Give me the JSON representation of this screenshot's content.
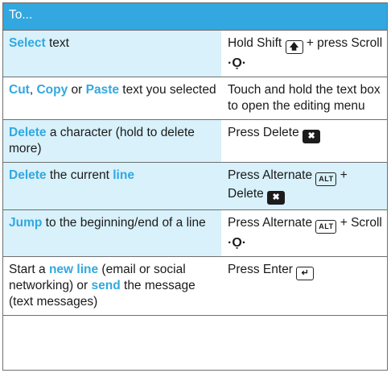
{
  "header": {
    "label": "To..."
  },
  "rows": [
    {
      "pre": "",
      "kw1": "Select",
      "mid1": " text",
      "kw2": "",
      "mid2": "",
      "kw3": "",
      "post": "",
      "action_pre": "Hold Shift ",
      "key1": "up-arrow-key",
      "action_mid": " + press Scroll ",
      "key2": "scroll-icon",
      "action_post": ""
    },
    {
      "pre": "",
      "kw1": "Cut",
      "mid1": ", ",
      "kw2": "Copy",
      "mid2": " or ",
      "kw3": "Paste",
      "post": " text you selected",
      "action_pre": "Touch and hold the text box to open the editing menu",
      "key1": "",
      "action_mid": "",
      "key2": "",
      "action_post": ""
    },
    {
      "pre": "",
      "kw1": "Delete",
      "mid1": " a character (hold to delete more)",
      "kw2": "",
      "mid2": "",
      "kw3": "",
      "post": "",
      "action_pre": "Press Delete ",
      "key1": "delete-key",
      "action_mid": "",
      "key2": "",
      "action_post": ""
    },
    {
      "pre": "",
      "kw1": "Delete",
      "mid1": " the current ",
      "kw2": "line",
      "mid2": "",
      "kw3": "",
      "post": "",
      "action_pre": "Press Alternate ",
      "key1": "alt-key",
      "action_mid": " + Delete ",
      "key2": "delete-key",
      "action_post": ""
    },
    {
      "pre": "",
      "kw1": "Jump",
      "mid1": " to the beginning/end of a line",
      "kw2": "",
      "mid2": "",
      "kw3": "",
      "post": "",
      "action_pre": "Press Alternate ",
      "key1": "alt-key",
      "action_mid": " + Scroll ",
      "key2": "scroll-icon",
      "action_post": ""
    },
    {
      "pre": "Start a ",
      "kw1": "new line",
      "mid1": " (email or social networking) or ",
      "kw2": "send",
      "mid2": " the message (text messages)",
      "kw3": "",
      "post": "",
      "action_pre": "Press Enter ",
      "key1": "enter-key",
      "action_mid": "",
      "key2": "",
      "action_post": ""
    }
  ],
  "keys": {
    "alt_label": "ALT"
  },
  "colors": {
    "header_bg": "#33a7e0",
    "highlight_bg": "#d8f1fb",
    "keyword": "#31a8e0"
  }
}
